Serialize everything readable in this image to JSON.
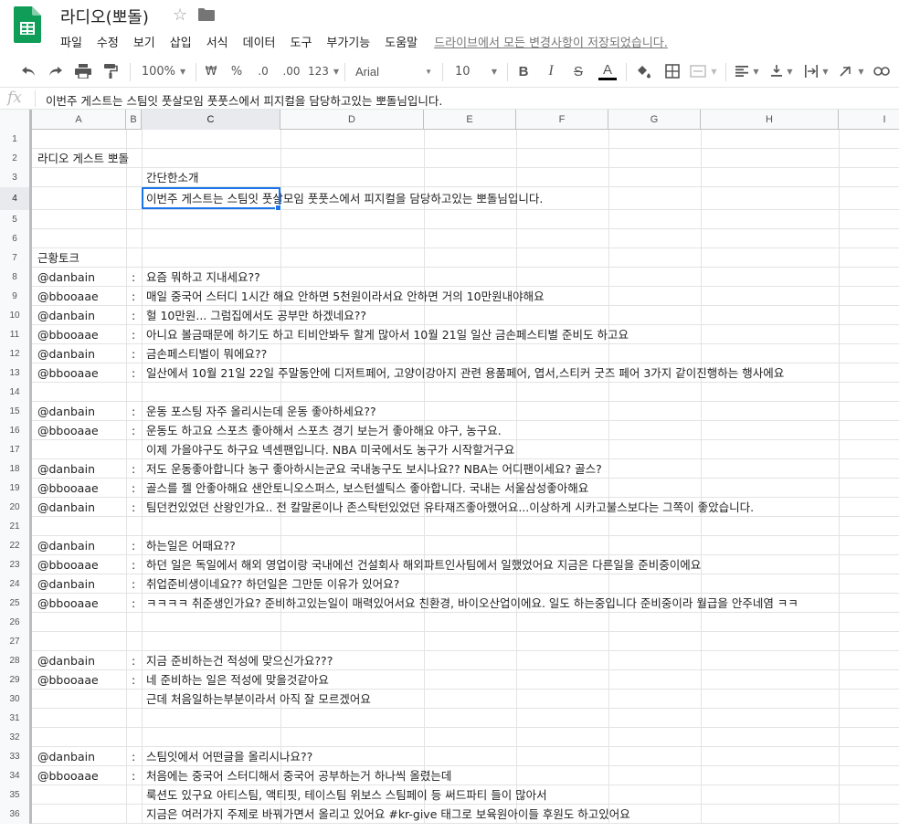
{
  "header": {
    "title": "라디오(뽀돌)",
    "star_icon": "star-icon",
    "folder_icon": "folder-icon",
    "menu": [
      "파일",
      "수정",
      "보기",
      "삽입",
      "서식",
      "데이터",
      "도구",
      "부가기능",
      "도움말"
    ],
    "save_status": "드라이브에서 모든 변경사항이 저장되었습니다."
  },
  "toolbar": {
    "zoom": "100%",
    "currency": "₩",
    "percent": "%",
    "dec_less": ".0",
    "dec_more": ".00",
    "format_more": "123",
    "font": "Arial",
    "font_size": "10",
    "icons": [
      "undo-icon",
      "redo-icon",
      "print-icon",
      "paint-format-icon",
      "bold-icon",
      "italic-icon",
      "strikethrough-icon",
      "text-color-icon",
      "fill-color-icon",
      "borders-icon",
      "merge-icon",
      "align-left-icon",
      "valign-bottom-icon",
      "text-wrap-icon",
      "text-rotate-icon",
      "link-icon"
    ],
    "text_color": "#000000"
  },
  "formula_bar": {
    "fx": "fx",
    "content": "이번주 게스트는 스팀잇 풋살모임 풋풋스에서 피지컬을 담당하고있는 뽀돌님입니다."
  },
  "columns": [
    "A",
    "B",
    "C",
    "D",
    "E",
    "F",
    "G",
    "H",
    "I"
  ],
  "selected_cell": "C4",
  "rows": [
    {
      "n": "1",
      "a": "",
      "b": "",
      "c": ""
    },
    {
      "n": "2",
      "a": "라디오 게스트 뽀돌",
      "b": "",
      "c": ""
    },
    {
      "n": "3",
      "a": "",
      "b": "",
      "c": "간단한소개"
    },
    {
      "n": "4",
      "a": "",
      "b": "",
      "c": "이번주 게스트는 스팀잇 풋살모임 풋풋스에서 피지컬을 담당하고있는 뽀돌님입니다."
    },
    {
      "n": "5",
      "a": "",
      "b": "",
      "c": ""
    },
    {
      "n": "6",
      "a": "",
      "b": "",
      "c": ""
    },
    {
      "n": "7",
      "a": "근황토크",
      "b": "",
      "c": ""
    },
    {
      "n": "8",
      "a": "@danbain",
      "b": ":",
      "c": "요즘 뭐하고 지내세요??"
    },
    {
      "n": "9",
      "a": "@bbooaae",
      "b": ":",
      "c": "매일 중국어 스터디 1시간 해요 안하면 5천원이라서요 안하면 거의 10만원내야해요"
    },
    {
      "n": "10",
      "a": "@danbain",
      "b": ":",
      "c": "헐 10만원... 그럼집에서도 공부만 하겠네요??"
    },
    {
      "n": "11",
      "a": "@bbooaae",
      "b": ":",
      "c": "아니요 볼금때문에 하기도 하고 티비안봐두 할게 많아서  10월 21일 일산 금손페스티벌 준비도 하고요"
    },
    {
      "n": "12",
      "a": "@danbain",
      "b": ":",
      "c": "금손페스티벌이 뭐에요??"
    },
    {
      "n": "13",
      "a": "@bbooaae",
      "b": ":",
      "c": "일산에서 10월 21일 22일 주말동안에 디저트페어, 고양이강아지 관련 용품페어, 엽서,스티커 굿즈 페어 3가지 같이진행하는 행사에요"
    },
    {
      "n": "14",
      "a": "",
      "b": "",
      "c": ""
    },
    {
      "n": "15",
      "a": "@danbain",
      "b": ":",
      "c": "운동 포스팅 자주 올리시는데 운동 좋아하세요??"
    },
    {
      "n": "16",
      "a": "@bbooaae",
      "b": ":",
      "c": "운동도 하고요 스포츠 좋아해서 스포츠 경기 보는거 좋아해요 야구, 농구요."
    },
    {
      "n": "17",
      "a": "",
      "b": "",
      "c": "이제 가을야구도 하구요 넥센팬입니다. NBA 미국에서도 농구가 시작할거구요"
    },
    {
      "n": "18",
      "a": "@danbain",
      "b": ":",
      "c": "저도 운동좋아합니다 농구 좋아하시는군요 국내농구도 보시나요?? NBA는 어디팬이세요? 골스?"
    },
    {
      "n": "19",
      "a": "@bbooaae",
      "b": ":",
      "c": "골스를 젤 안좋아해요 샌안토니오스퍼스, 보스턴셀틱스 좋아합니다. 국내는 서울삼성좋아해요"
    },
    {
      "n": "20",
      "a": "@danbain",
      "b": ":",
      "c": "팀던컨있었던 산왕인가요.. 전 칼말론이나 존스탁턴있었던 유타재즈좋아했어요...이상하게 시카고불스보다는 그쪽이 좋았습니다."
    },
    {
      "n": "21",
      "a": "",
      "b": "",
      "c": ""
    },
    {
      "n": "22",
      "a": "@danbain",
      "b": ":",
      "c": "하는일은 어때요??"
    },
    {
      "n": "23",
      "a": "@bbooaae",
      "b": ":",
      "c": "하던 일은 독일에서 해외 영업이랑 국내에선 건설회사 해외파트인사팀에서 일했었어요  지금은 다른일을 준비중이에요"
    },
    {
      "n": "24",
      "a": "@danbain",
      "b": ":",
      "c": "취업준비생이네요?? 하던일은 그만둔 이유가 있어요?"
    },
    {
      "n": "25",
      "a": "@bbooaae",
      "b": ":",
      "c": "ㅋㅋㅋㅋ 취준생인가요? 준비하고있는일이 매력있어서요 친환경, 바이오산업이에요. 일도 하는중입니다 준비중이라 월급을 안주네염 ㅋㅋ"
    },
    {
      "n": "26",
      "a": "",
      "b": "",
      "c": ""
    },
    {
      "n": "27",
      "a": "",
      "b": "",
      "c": ""
    },
    {
      "n": "28",
      "a": "@danbain",
      "b": ":",
      "c": "지금 준비하는건 적성에 맞으신가요???"
    },
    {
      "n": "29",
      "a": "@bbooaae",
      "b": ":",
      "c": "네 준비하는 일은 적성에 맞을것같아요"
    },
    {
      "n": "30",
      "a": "",
      "b": "",
      "c": "근데 처음일하는부분이라서 아직 잘 모르겠어요"
    },
    {
      "n": "31",
      "a": "",
      "b": "",
      "c": ""
    },
    {
      "n": "32",
      "a": "",
      "b": "",
      "c": ""
    },
    {
      "n": "33",
      "a": "@danbain",
      "b": ":",
      "c": "스팀잇에서 어떤글을 올리시나요??"
    },
    {
      "n": "34",
      "a": "@bbooaae",
      "b": ":",
      "c": "처음에는 중국어 스터디해서 중국어 공부하는거 하나씩 올렸는데"
    },
    {
      "n": "35",
      "a": "",
      "b": "",
      "c": "룩션도 있구요 아티스팀, 액티핏, 테이스팀 위보스 스팀페이 등 써드파티 들이 많아서"
    },
    {
      "n": "36",
      "a": "",
      "b": "",
      "c": "지금은 여러가지 주제로 바꿔가면서 올리고 있어요 #kr-give 태그로 보육원아이들 후원도 하고있어요"
    }
  ],
  "colors": {
    "accent": "#1a73e8",
    "sheets_green": "#0f9d58",
    "header_bg": "#f8f9fa"
  }
}
